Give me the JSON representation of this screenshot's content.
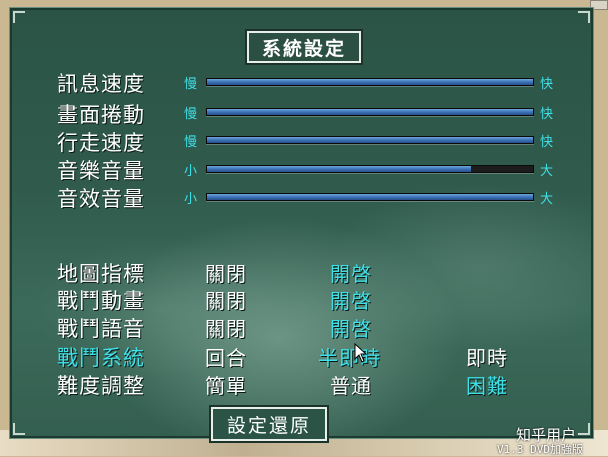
{
  "title": "系統設定",
  "sliders": [
    {
      "label": "訊息速度",
      "min_label": "慢",
      "max_label": "快",
      "level": 1.0
    },
    {
      "label": "畫面捲動",
      "min_label": "慢",
      "max_label": "快",
      "level": 1.0
    },
    {
      "label": "行走速度",
      "min_label": "慢",
      "max_label": "快",
      "level": 1.0
    },
    {
      "label": "音樂音量",
      "min_label": "小",
      "max_label": "大",
      "level": 0.81
    },
    {
      "label": "音效音量",
      "min_label": "小",
      "max_label": "大",
      "level": 1.0
    }
  ],
  "options": [
    {
      "label": "地圖指標",
      "label_highlight": false,
      "choices": [
        "關閉",
        "開啓"
      ],
      "selected": 1
    },
    {
      "label": "戰鬥動畫",
      "label_highlight": false,
      "choices": [
        "關閉",
        "開啓"
      ],
      "selected": 1
    },
    {
      "label": "戰鬥語音",
      "label_highlight": false,
      "choices": [
        "關閉",
        "開啓"
      ],
      "selected": 1
    },
    {
      "label": "戰鬥系統",
      "label_highlight": true,
      "choices": [
        "回合",
        "半即時",
        "即時"
      ],
      "selected": 1
    },
    {
      "label": "難度調整",
      "label_highlight": false,
      "choices": [
        "簡單",
        "普通",
        "困難"
      ],
      "selected": 2
    }
  ],
  "reset_label": "設定還原",
  "watermark": "知乎用户",
  "version": "V1.3 DVD加強版",
  "colors": {
    "highlight": "#3fe0e8",
    "text": "#ffffff",
    "panel": "#2f5a4c",
    "slider_fill": "#3c74b8"
  }
}
